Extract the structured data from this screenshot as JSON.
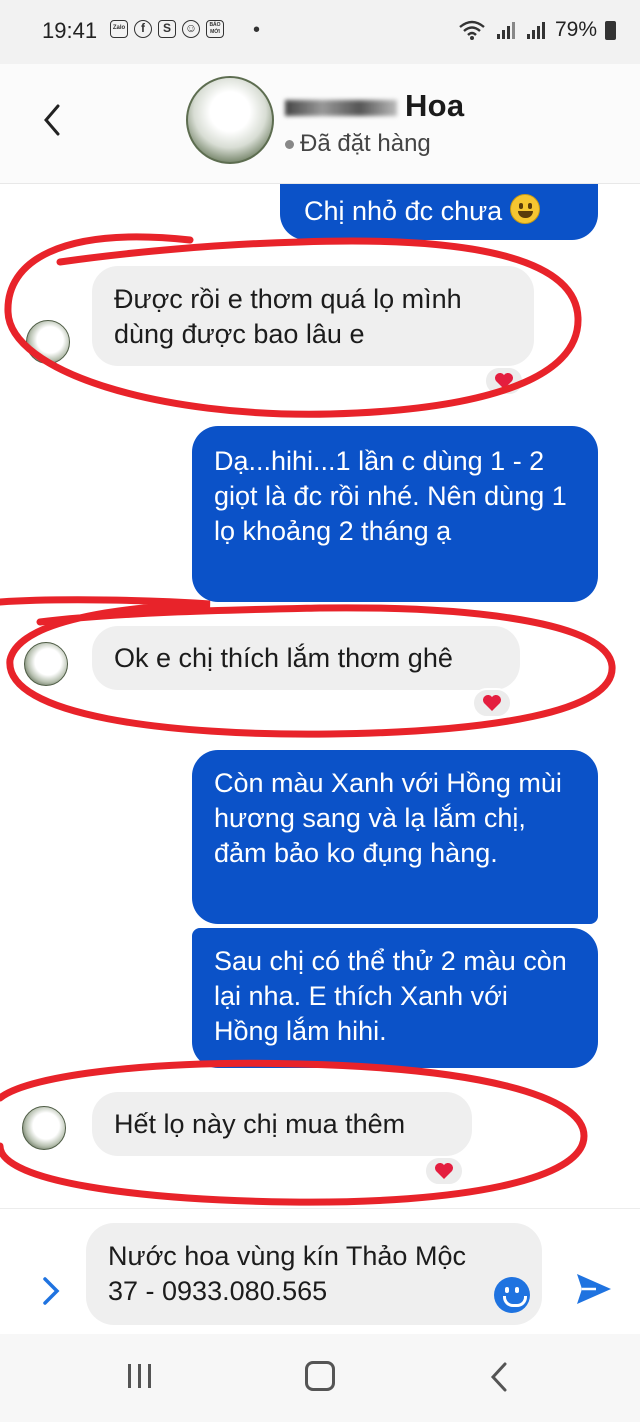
{
  "status_bar": {
    "time": "19:41",
    "app_icons": [
      "Zalo",
      "f",
      "S",
      "☺",
      "BÁO MỚI"
    ],
    "battery": "79%"
  },
  "header": {
    "contact_name": "Hoa",
    "contact_status": "Đã đặt hàng"
  },
  "messages": [
    {
      "from": "me",
      "text": "Chị nhỏ đc chưa",
      "has_emoji": true
    },
    {
      "from": "them",
      "text": "Được rồi e thơm quá lọ mình dùng được bao lâu e",
      "reaction": "heart"
    },
    {
      "from": "me",
      "text": "Dạ...hihi...1 lần c dùng 1 - 2 giọt là đc rồi nhé. Nên dùng 1 lọ khoảng 2 tháng ạ"
    },
    {
      "from": "them",
      "text": "Ok e chị thích lắm thơm ghê",
      "reaction": "heart"
    },
    {
      "from": "me",
      "text": "Còn màu Xanh với Hồng mùi hương sang và lạ lắm chị, đảm bảo ko đụng hàng."
    },
    {
      "from": "me",
      "text": "Sau chị có thể thử 2 màu còn lại nha. E thích Xanh với Hồng lắm hihi."
    },
    {
      "from": "them",
      "text": "Hết lọ này chị mua thêm",
      "reaction": "heart"
    }
  ],
  "composer": {
    "value": "Nước hoa vùng kín Thảo Mộc 37 - 0933.080.565"
  },
  "colors": {
    "outgoing_bubble": "#0b52c8",
    "incoming_bubble": "#efefef",
    "highlight_circle": "#e8232a",
    "reaction_heart": "#e41e3f",
    "accent": "#1f73e0"
  }
}
